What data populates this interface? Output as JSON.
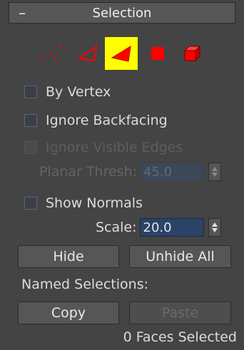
{
  "rollout": {
    "collapse_symbol": "–",
    "title": "Selection"
  },
  "modes": [
    {
      "name": "vertex",
      "icon": "vertex-dots-icon",
      "active": false
    },
    {
      "name": "edge",
      "icon": "edge-triangle-outline-icon",
      "active": false
    },
    {
      "name": "face",
      "icon": "face-filled-triangle-icon",
      "active": true
    },
    {
      "name": "polygon",
      "icon": "polygon-square-icon",
      "active": false
    },
    {
      "name": "element",
      "icon": "element-cube-icon",
      "active": false
    }
  ],
  "options": {
    "by_vertex": "By Vertex",
    "ignore_backfacing": "Ignore Backfacing",
    "ignore_visible_edges": "Ignore Visible Edges",
    "planar_thresh_label": "Planar Thresh:",
    "planar_thresh_value": "45.0",
    "show_normals": "Show Normals",
    "scale_label": "Scale:",
    "scale_value": "20.0"
  },
  "buttons": {
    "hide": "Hide",
    "unhide_all": "Unhide All",
    "copy": "Copy",
    "paste": "Paste"
  },
  "named_selections_label": "Named Selections:",
  "status": "0 Faces Selected",
  "colors": {
    "accent_red": "#ff0000",
    "active_yellow": "#ffff00",
    "spinner_blue": "#2a4366",
    "panel_bg": "#444444"
  }
}
